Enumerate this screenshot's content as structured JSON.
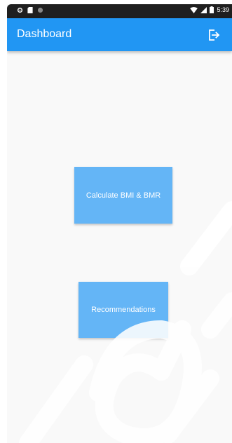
{
  "status_bar": {
    "time": "5:39",
    "icons": [
      "gear-icon",
      "sd-card-icon",
      "circle-icon",
      "wifi-icon",
      "signal-icon",
      "battery-icon"
    ]
  },
  "app_bar": {
    "title": "Dashboard",
    "action_icon": "logout-icon",
    "color": "#2196f3"
  },
  "actions": {
    "calculate_label": "Calculate BMI & BMR",
    "recommendations_label": "Recommendations",
    "button_color": "#64b5f6"
  }
}
